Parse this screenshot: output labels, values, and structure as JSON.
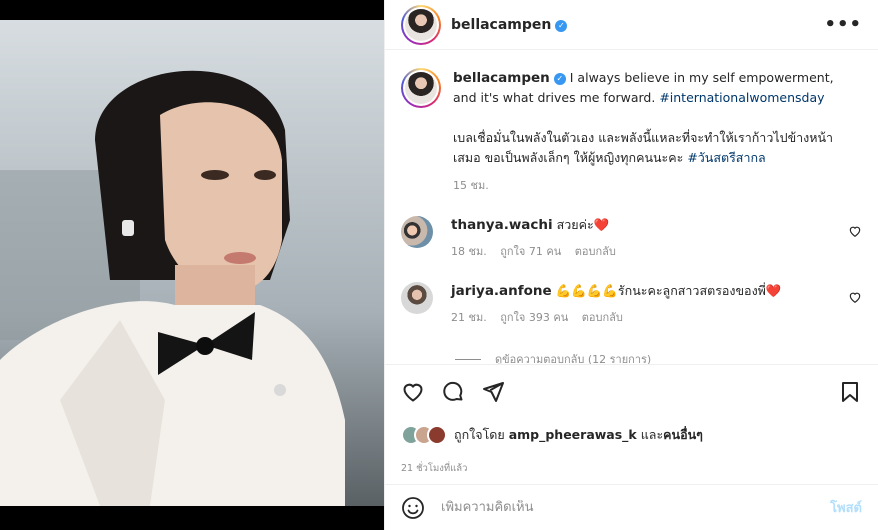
{
  "post": {
    "author": "bellacampen",
    "verified_mark": "✓",
    "more_label": "•••"
  },
  "caption": {
    "username": "bellacampen",
    "text_en": " I always believe in my self empowerment, and it's what drives me forward. ",
    "tag_en": "#internationalwomensday",
    "text_th": "เบลเชื่อมั่นในพลังในตัวเอง และพลังนี้แหละที่จะทำให้เราก้าวไปข้างหน้าเสมอ ขอเป็นพลังเล็กๆ ให้ผู้หญิงทุกคนนะคะ ",
    "tag_th": "#วันสตรีสากล",
    "time": "15 ชม."
  },
  "comments": [
    {
      "username": "thanya.wachi",
      "text": " สวยค่ะ",
      "emoji": "❤️",
      "time": "18 ชม.",
      "likes": "ถูกใจ 71 คน",
      "reply": "ตอบกลับ"
    },
    {
      "username": "jariya.anfone",
      "text": " 💪💪💪💪รักนะคะลูกสาวสตรองของพี่",
      "emoji": "❤️",
      "time": "21 ชม.",
      "likes": "ถูกใจ 393 คน",
      "reply": "ตอบกลับ"
    }
  ],
  "view_replies": "ดูข้อความตอบกลับ (12 รายการ)",
  "liked_by": {
    "prefix": "ถูกใจโดย ",
    "user": "amp_pheerawas_k",
    "middle": " และ",
    "others": "คนอื่นๆ"
  },
  "posted_ago": "21 ชั่วโมงที่แล้ว",
  "add_comment": {
    "placeholder": "เพิ่มความคิดเห็น",
    "post_label": "โพสต์"
  },
  "icons": [
    "heart-icon",
    "comment-icon",
    "share-icon",
    "save-icon",
    "emoji-icon",
    "more-icon"
  ],
  "colors": {
    "link": "#00376b",
    "muted": "#8e8e8e",
    "post_button": "#b2dffc",
    "heart": "#ed4956",
    "verified": "#3897f0"
  }
}
